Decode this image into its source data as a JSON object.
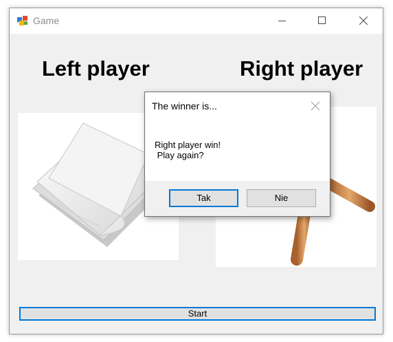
{
  "window": {
    "title": "Game",
    "icon": "app-icon"
  },
  "labels": {
    "left_player": "Left player",
    "right_player": "Right player"
  },
  "images": {
    "left": "paper-icon",
    "right": "bat-icon"
  },
  "start_button": "Start",
  "dialog": {
    "title": "The winner is...",
    "message": "Right player win!\n Play again?",
    "yes_button": "Tak",
    "no_button": "Nie"
  },
  "colors": {
    "accent": "#0078d7",
    "window_bg": "#f0f0f0",
    "button_bg": "#e1e1e1"
  }
}
